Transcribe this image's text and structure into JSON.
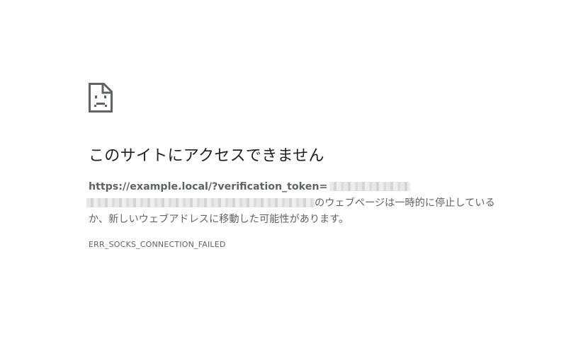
{
  "error_page": {
    "icon": "sad-document-icon",
    "title": "このサイトにアクセスできません",
    "url": "https://example.local/?verification_token=",
    "message_line1": "のウェブページは一時的に停止している",
    "message_line2": "か、新しいウェブアドレスに移動した可能性があります。",
    "error_code": "ERR_SOCKS_CONNECTION_FAILED",
    "colors": {
      "title": "#202124",
      "body": "#5f6368",
      "background": "#ffffff"
    }
  }
}
